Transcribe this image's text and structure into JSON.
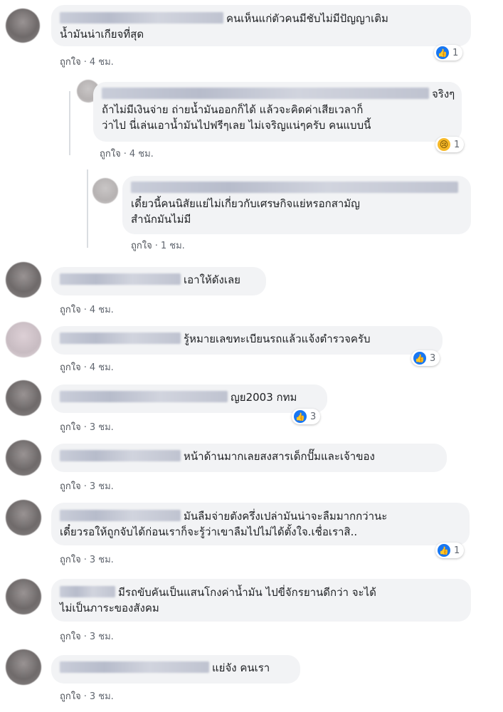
{
  "comments": [
    {
      "lines": [
        "คนเห็นแก่ตัวคนมีชับไม่มีปัญญาเติม",
        "น้ำมันน่าเกียจที่สุด"
      ],
      "like_label": "ถูกใจ",
      "time": "4 ชม.",
      "reaction_count": "1",
      "reaction_type": "like-icon"
    },
    {
      "lines": [
        "จริงๆ",
        "ถ้าไม่มีเงินจ่าย ถ่ายน้ำมันออกก็ได้ แล้วจะคิดค่าเสียเวลาก็",
        "ว่าไป นี่เล่นเอาน้ำมันไปฟรีๆเลย ไม่เจริญแน่ๆครับ คนแบบนี้"
      ],
      "like_label": "ถูกใจ",
      "time": "4 ชม.",
      "reaction_count": "1",
      "reaction_type": "sad-icon"
    },
    {
      "lines": [
        "เดี๋ยวนี้คนนิสัยแย่ไม่เกี่ยวกับเศรษกิจแย่หรอกสามัญ",
        "สำนักมันไม่มี"
      ],
      "like_label": "ถูกใจ",
      "time": "1 ชม."
    },
    {
      "lines": [
        "เอาให้ดังเลย"
      ],
      "like_label": "ถูกใจ",
      "time": "4 ชม."
    },
    {
      "lines": [
        "รู้หมายเลขทะเบียนรถแล้วแจ้งตำรวจครับ"
      ],
      "like_label": "ถูกใจ",
      "time": "4 ชม.",
      "reaction_count": "3",
      "reaction_type": "like-icon"
    },
    {
      "lines": [
        "ญย2003 กทม"
      ],
      "like_label": "ถูกใจ",
      "time": "3 ชม.",
      "reaction_count": "3",
      "reaction_type": "like-icon"
    },
    {
      "lines": [
        "หน้าด้านมากเลยสงสารเด็กปั๊มและเจ้าของ"
      ],
      "like_label": "ถูกใจ",
      "time": "3 ชม."
    },
    {
      "lines": [
        "มันลืมจ่ายตังครึ่งเปล่ามันน่าจะลืมมากกว่านะ",
        "เดี๋ยวรอให้ถูกจับได้ก่อนเราก็จะรู้ว่าเขาลืมไปไม่ได้ตั้งใจ.เชื่อเราสิ.."
      ],
      "like_label": "ถูกใจ",
      "time": "3 ชม.",
      "reaction_count": "1",
      "reaction_type": "like-icon"
    },
    {
      "lines": [
        "มีรถขับคันเป็นแสนโกงค่าน้ำมัน ไปขี่จักรยานดีกว่า จะได้",
        "ไม่เป็นภาระของสังคม"
      ],
      "like_label": "ถูกใจ",
      "time": "3 ชม."
    },
    {
      "lines": [
        "แย่จัง คนเรา"
      ],
      "like_label": "ถูกใจ",
      "time": "3 ชม."
    }
  ],
  "colors": {
    "bubble": "#f2f3f5",
    "link": "#616770",
    "reaction": "#1877f2"
  }
}
